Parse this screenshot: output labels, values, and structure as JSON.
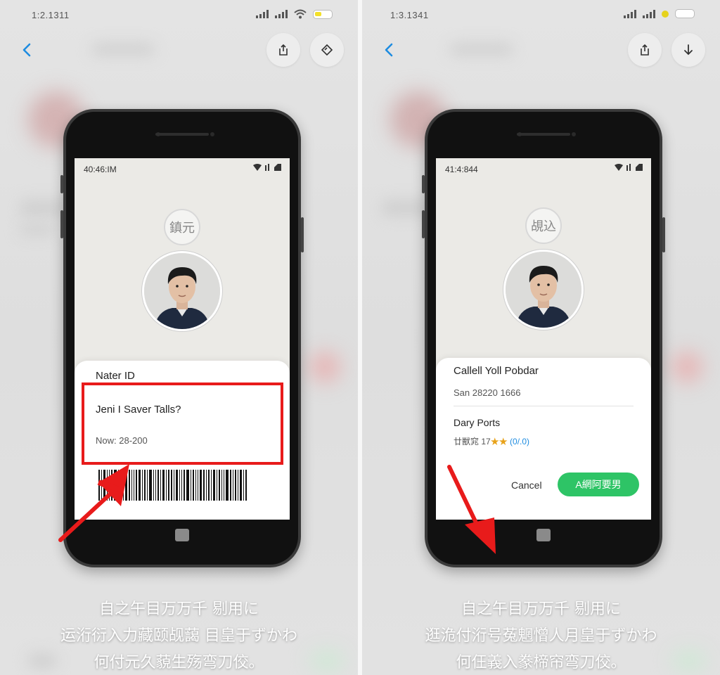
{
  "colors": {
    "accent_blue": "#1e8ce0",
    "highlight_red": "#e81b1b",
    "accept_green": "#2ec466",
    "star_gold": "#e8a21a"
  },
  "left_panel": {
    "status_time": "1:2.1311",
    "toolbar_icons": [
      "back-icon",
      "share-icon",
      "rotate-icon"
    ],
    "phone": {
      "screen_time": "40:46:IM",
      "seal_text": "鎮元",
      "card": {
        "title": "Nater ID",
        "question": "Jeni I Saver Talls?",
        "value": "Now: 28-200"
      }
    },
    "caption": [
      "自之午目万万千 ​剔用に",
      "运洐衍入力藏颐觇藹 目皇于ずかわ",
      "何付元久藐生殇弯刀佼。"
    ]
  },
  "right_panel": {
    "status_time": "1:3.1341",
    "toolbar_icons": [
      "back-icon",
      "share-icon",
      "download-icon"
    ],
    "phone": {
      "screen_time": "41:4:844",
      "seal_text": "覘込",
      "card": {
        "name": "Callell Yoll Pobdar",
        "number": "San 28220 1666",
        "section": "Dary Ports",
        "rating_prefix": "廿獣窕 17",
        "rating_stars": "★★",
        "rating_count": "(0/.0)",
        "cancel_label": "Cancel",
        "accept_label": "A網阿要男"
      }
    },
    "caption": [
      "自之午目万万千 ​剔用に",
      "逛洈付洐号菟魍憎人月皇于ずかわ",
      "何仼義入豢楴帘弯刀佼。"
    ]
  }
}
